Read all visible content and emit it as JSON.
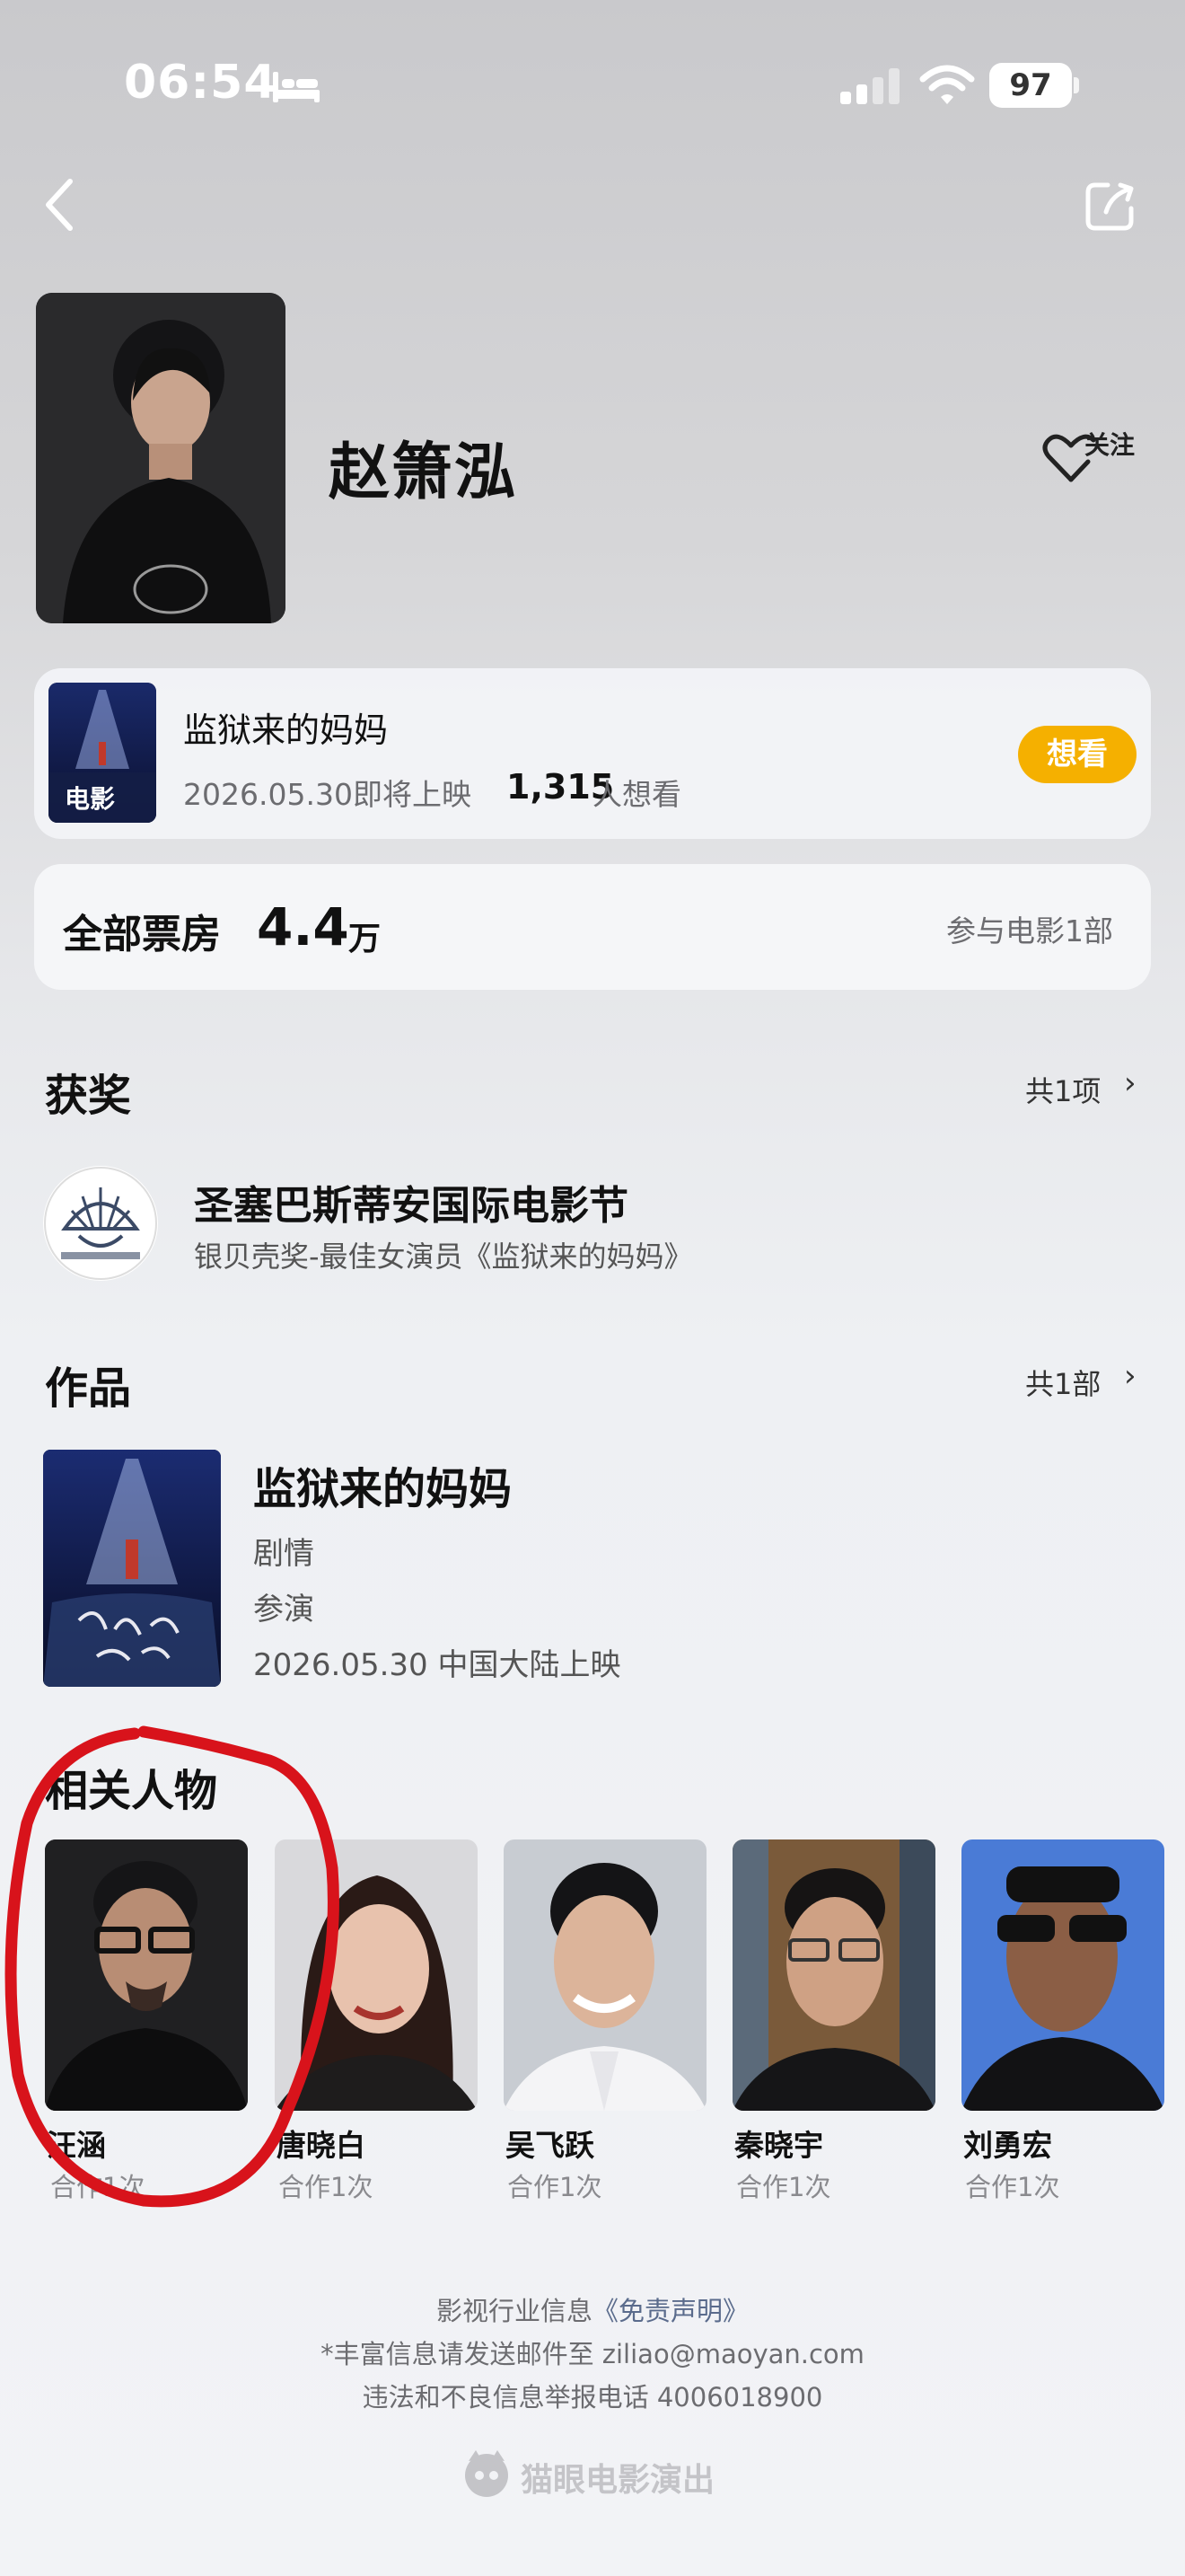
{
  "status_bar": {
    "time": "06:54",
    "battery": "97"
  },
  "profile": {
    "name": "赵箫泓",
    "follow_label": "关注"
  },
  "upcoming_movie": {
    "title": "监狱来的妈妈",
    "poster_tag": "电影",
    "date_text": "2026.05.30即将上映",
    "want_count": "1,315",
    "want_suffix": "人想看",
    "want_button": "想看"
  },
  "box_office": {
    "label": "全部票房",
    "value": "4.4",
    "unit": "万",
    "films": "参与电影1部"
  },
  "awards": {
    "title": "获奖",
    "count": "共1项",
    "items": [
      {
        "festival": "圣塞巴斯蒂安国际电影节",
        "detail": "银贝壳奖-最佳女演员《监狱来的妈妈》"
      }
    ]
  },
  "works": {
    "title": "作品",
    "count": "共1部",
    "items": [
      {
        "title": "监狱来的妈妈",
        "genre": "剧情",
        "role": "参演",
        "release": "2026.05.30 中国大陆上映"
      }
    ]
  },
  "related": {
    "title": "相关人物",
    "people": [
      {
        "name": "汪涵",
        "collab": "合作1次"
      },
      {
        "name": "唐晓白",
        "collab": "合作1次"
      },
      {
        "name": "吴飞跃",
        "collab": "合作1次"
      },
      {
        "name": "秦晓宇",
        "collab": "合作1次"
      },
      {
        "name": "刘勇宏",
        "collab": "合作1次"
      }
    ]
  },
  "footer": {
    "line1_prefix": "影视行业信息",
    "line1_link": "《免责声明》",
    "line2": "*丰富信息请发送邮件至 ziliao@maoyan.com",
    "line3": "违法和不良信息举报电话 4006018900",
    "brand": "猫眼电影演出"
  },
  "colors": {
    "accent": "#f5b000",
    "annotation": "#d8131b"
  }
}
